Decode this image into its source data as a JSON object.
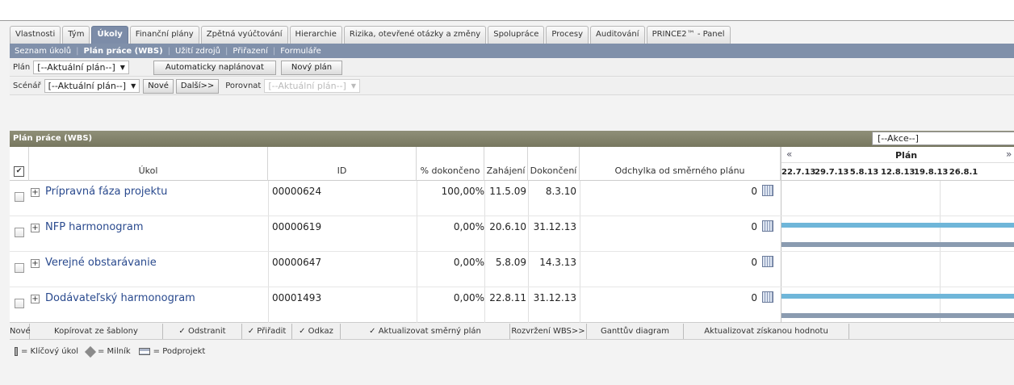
{
  "tabs": [
    "Vlastnosti",
    "Tým",
    "Úkoly",
    "Finanční plány",
    "Zpětná vyúčtování",
    "Hierarchie",
    "Rizika, otevřené otázky a změny",
    "Spolupráce",
    "Procesy",
    "Auditování",
    "PRINCE2™ - Panel"
  ],
  "subnav": [
    "Seznam úkolů",
    "Plán práce (WBS)",
    "Užití zdrojů",
    "Přiřazení",
    "Formuláře"
  ],
  "plan": {
    "label": "Plán",
    "value": "[--Aktuální plán--]",
    "auto_btn": "Automaticky naplánovat",
    "new_btn": "Nový plán"
  },
  "scenario": {
    "label": "Scénář",
    "value": "[--Aktuální plán--]",
    "new_btn": "Nové",
    "next_btn": "Další>>",
    "compare_label": "Porovnat",
    "compare_value": "[--Aktuální plán--]"
  },
  "panel": {
    "title": "Plán práce (WBS)",
    "actions": "[--Akce--]"
  },
  "columns": {
    "task": "Úkol",
    "id": "ID",
    "pct": "% dokončeno",
    "start": "Zahájení",
    "end": "Dokončení",
    "deviation": "Odchylka od směrného plánu",
    "plan": "Plán"
  },
  "gantt_dates": [
    "22.7.13",
    "29.7.13",
    "5.8.13",
    "12.8.13",
    "19.8.13",
    "26.8.1"
  ],
  "rows": [
    {
      "name": "Prípravná fáza projektu",
      "id": "00000624",
      "pct": "100,00%",
      "start": "11.5.09",
      "end": "8.3.10",
      "dev": "0"
    },
    {
      "name": "NFP harmonogram",
      "id": "00000619",
      "pct": "0,00%",
      "start": "20.6.10",
      "end": "31.12.13",
      "dev": "0"
    },
    {
      "name": "Verejné obstarávanie",
      "id": "00000647",
      "pct": "0,00%",
      "start": "5.8.09",
      "end": "14.3.13",
      "dev": "0"
    },
    {
      "name": "Dodávateľský harmonogram",
      "id": "00001493",
      "pct": "0,00%",
      "start": "22.8.11",
      "end": "31.12.13",
      "dev": "0"
    }
  ],
  "toolbar": [
    "Nové",
    "Kopírovat ze šablony",
    "✓ Odstranit",
    "✓ Přiřadit",
    "✓ Odkaz",
    "✓ Aktualizovat směrný plán",
    "Rozvržení WBS>>",
    "Ganttův diagram",
    "Aktualizovat získanou hodnotu"
  ],
  "legend": {
    "key": "= Klíčový úkol",
    "milestone": "= Milník",
    "subproject": "= Podprojekt"
  },
  "colors": {
    "active_tab": "#7c8ca8",
    "subnav": "#8090aa",
    "panel_header": "#858570",
    "link": "#2a4a8e",
    "bar_blue": "#6fb6d9",
    "bar_grey": "#8a9bb0"
  }
}
